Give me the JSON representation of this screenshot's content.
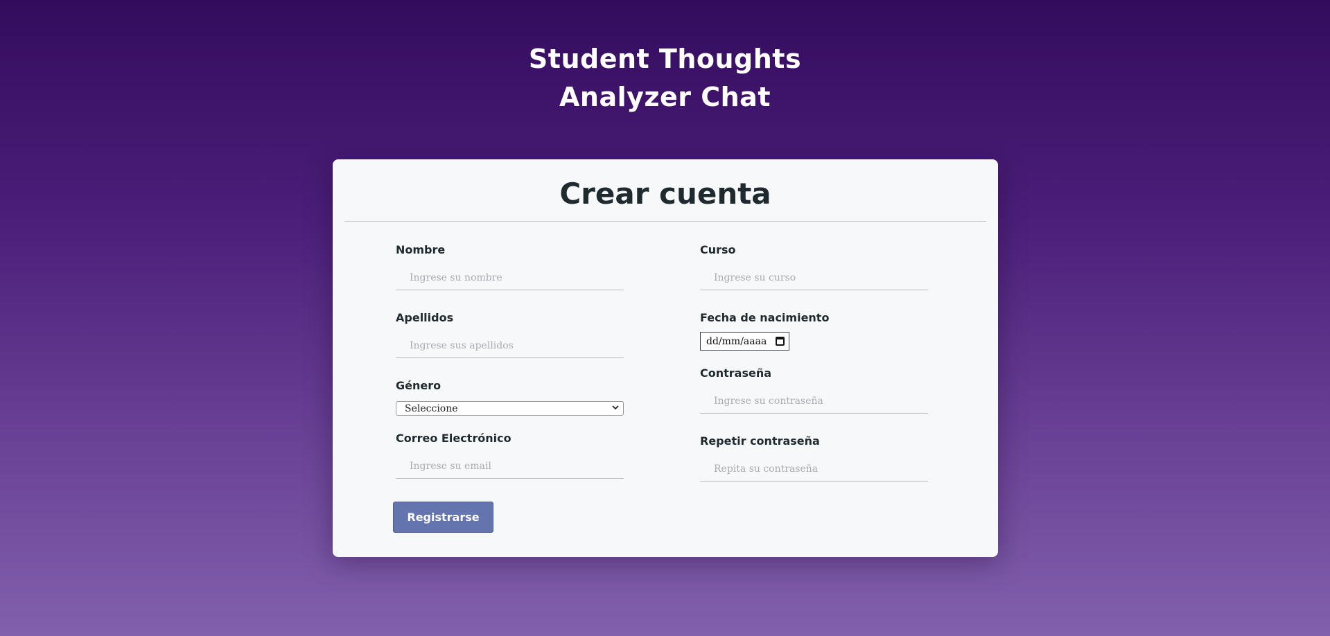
{
  "header": {
    "title_line1": "Student Thoughts",
    "title_line2": "Analyzer Chat"
  },
  "form": {
    "title": "Crear cuenta",
    "fields": {
      "nombre": {
        "label": "Nombre",
        "placeholder": "Ingrese su nombre",
        "value": ""
      },
      "apellidos": {
        "label": "Apellidos",
        "placeholder": "Ingrese sus apellidos",
        "value": ""
      },
      "genero": {
        "label": "Género",
        "selected": "Seleccione"
      },
      "correo": {
        "label": "Correo Electrónico",
        "placeholder": "Ingrese su email",
        "value": ""
      },
      "curso": {
        "label": "Curso",
        "placeholder": "Ingrese su curso",
        "value": ""
      },
      "fecha": {
        "label": "Fecha de nacimiento",
        "value": "dd/mm/aaaa"
      },
      "contrasena": {
        "label": "Contraseña",
        "placeholder": "Ingrese su contraseña",
        "value": ""
      },
      "repetir": {
        "label": "Repetir contraseña",
        "placeholder": "Repita su contraseña",
        "value": ""
      }
    },
    "submit_label": "Registrarse"
  },
  "colors": {
    "background_top": "#330c5e",
    "background_bottom": "#8260ad",
    "card": "#f7f8fa",
    "button": "#6374ae",
    "text": "#1f2a2e"
  },
  "icons": {
    "date_picker": "calendar-icon",
    "select": "chevron-down-icon"
  }
}
